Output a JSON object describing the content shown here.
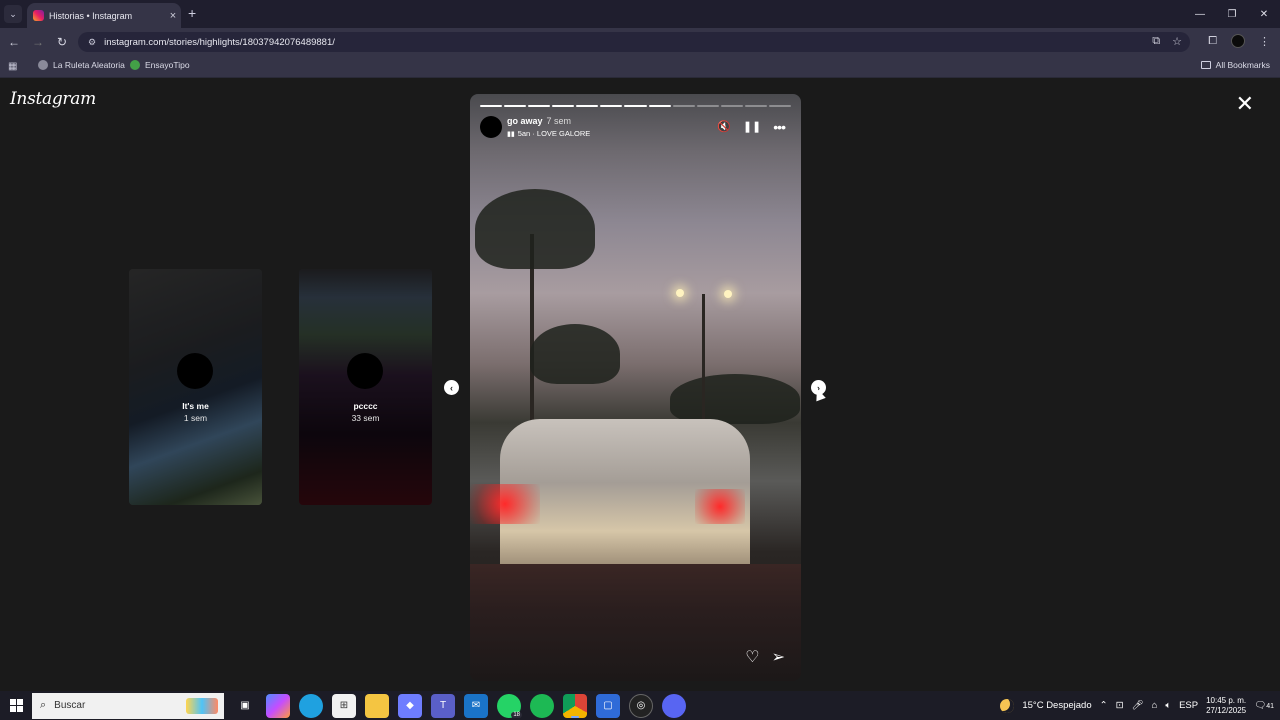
{
  "browser": {
    "tab_title": "Historias • Instagram",
    "tab_close": "×",
    "new_tab": "+",
    "url": "instagram.com/stories/highlights/18037942076489881/",
    "bookmarks": [
      {
        "label": "La Ruleta Aleatoria",
        "color": "#8a8a9a"
      },
      {
        "label": "EnsayoTipo",
        "color": "#43a047"
      }
    ],
    "all_bookmarks": "All Bookmarks"
  },
  "viewer": {
    "logo": "Instagram",
    "previews": [
      {
        "name": "It's me",
        "time": "1 sem"
      },
      {
        "name": "pcccc",
        "time": "33 sem"
      }
    ],
    "story": {
      "username": "go away",
      "age": "7 sem",
      "music": "5an · LOVE GALORE",
      "progress_total_segments": 13,
      "progress_filled_segments": 8
    }
  },
  "taskbar": {
    "search_placeholder": "Buscar",
    "whatsapp_badge": "18",
    "weather": "15°C  Despejado",
    "language": "ESP",
    "time": "10:45 p. m.",
    "date": "27/12/2025",
    "notifications": "41"
  }
}
